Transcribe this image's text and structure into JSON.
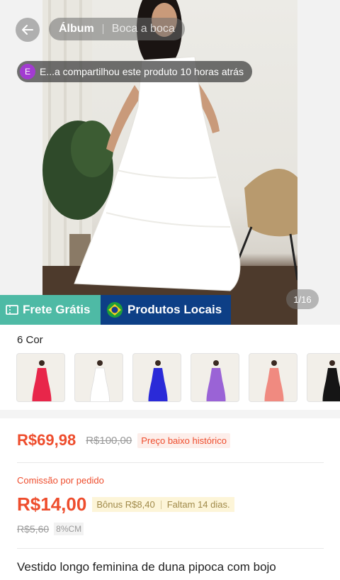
{
  "header": {
    "tabs": [
      {
        "label": "Álbum",
        "active": true
      },
      {
        "label": "Boca a boca",
        "active": false
      }
    ]
  },
  "share_notice": {
    "avatar_letter": "E",
    "text": "E...a compartilhou este produto 10 horas atrás"
  },
  "gallery": {
    "counter": "1/16"
  },
  "badges": {
    "frete": "Frete Grátis",
    "local": "Produtos Locais"
  },
  "colors": {
    "title": "6 Cor",
    "swatches": [
      {
        "name": "vermelho",
        "color": "#e8264a"
      },
      {
        "name": "branco",
        "color": "#ffffff"
      },
      {
        "name": "azul",
        "color": "#2a2ad8"
      },
      {
        "name": "lilás",
        "color": "#9a63d6"
      },
      {
        "name": "rosa",
        "color": "#f08a80"
      },
      {
        "name": "preto",
        "color": "#151515"
      }
    ]
  },
  "price": {
    "current": "R$69,98",
    "original": "R$100,00",
    "tag": "Preço baixo histórico"
  },
  "commission": {
    "label": "Comissão por pedido",
    "value": "R$14,00",
    "bonus": "Bônus R$8,40",
    "remaining": "Faltam 14 dias.",
    "old_value": "R$5,60",
    "percent": "8%CM"
  },
  "product": {
    "title": "Vestido longo feminina de duna pipoca com bojo"
  },
  "accent_color": "#ee4d2d"
}
